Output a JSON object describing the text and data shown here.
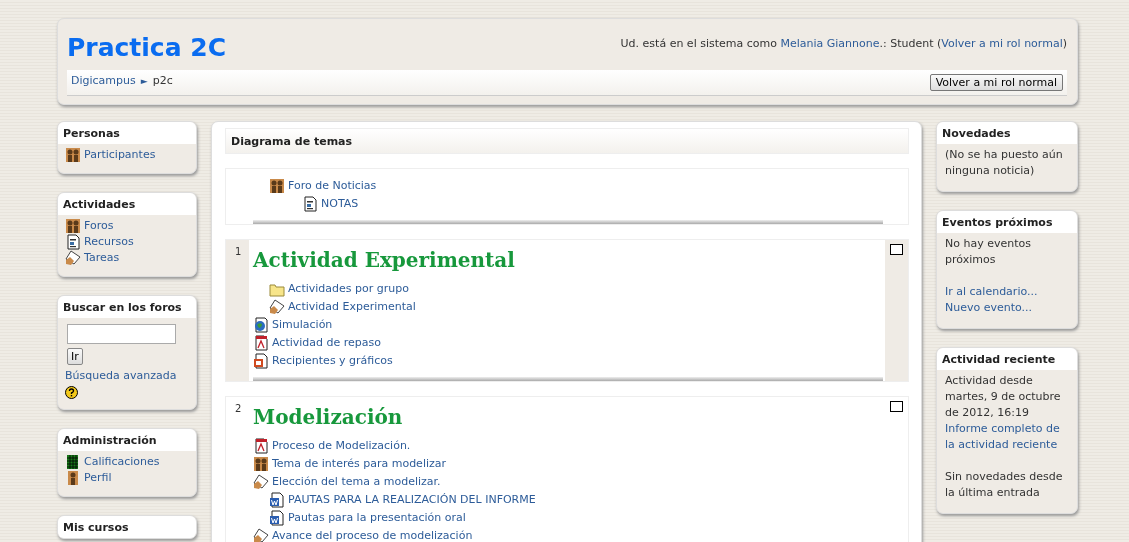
{
  "header": {
    "title": "Practica 2C",
    "login": {
      "prefix": "Ud. está en el sistema como",
      "user": "Melania Giannone",
      "role": ".: Student (",
      "link": "Volver a mi rol normal",
      "suffix": ")"
    },
    "breadcrumb": [
      {
        "label": "Digicampus",
        "link": true
      },
      {
        "label": "p2c",
        "link": false
      }
    ],
    "separator": "►",
    "button": "Volver a mi rol normal"
  },
  "left_blocks": [
    {
      "title": "Personas",
      "kind": "links",
      "items": [
        {
          "kind": "people",
          "label": "Participantes"
        }
      ]
    },
    {
      "title": "Actividades",
      "kind": "links",
      "items": [
        {
          "kind": "forum",
          "label": "Foros"
        },
        {
          "kind": "resource",
          "label": "Recursos"
        },
        {
          "kind": "assignment",
          "label": "Tareas"
        }
      ]
    },
    {
      "title": "Buscar en los foros",
      "kind": "search",
      "button": "Ir",
      "link": "Búsqueda avanzada"
    },
    {
      "title": "Administración",
      "kind": "links",
      "items": [
        {
          "kind": "grades",
          "label": "Calificaciones"
        },
        {
          "kind": "profile",
          "label": "Perfil"
        }
      ]
    },
    {
      "title": "Mis cursos",
      "kind": "links"
    }
  ],
  "main": {
    "title": "Diagrama de temas",
    "sections": [
      {
        "highlighted": false,
        "items": [
          {
            "kind": "forum",
            "label": "Foro de Noticias",
            "children": [
              {
                "kind": "resource",
                "label": "NOTAS"
              }
            ]
          }
        ]
      },
      {
        "number": "1",
        "title": "Actividad Experimental",
        "highlighted": true,
        "items": [
          {
            "children": [
              {
                "kind": "folder",
                "label": "Actividades por grupo"
              },
              {
                "kind": "assignment",
                "label": "Actividad Experimental"
              }
            ]
          },
          {
            "kind": "web",
            "label": "Simulación"
          },
          {
            "kind": "pdf",
            "label": "Actividad de repaso"
          },
          {
            "kind": "slides",
            "label": "Recipientes y gráficos"
          }
        ]
      },
      {
        "number": "2",
        "title": "Modelización",
        "highlighted": false,
        "items": [
          {
            "kind": "pdf",
            "label": "Proceso de Modelización."
          },
          {
            "kind": "forum",
            "label": "Tema de interés para modelizar"
          },
          {
            "kind": "assignment",
            "label": "Elección del tema a modelizar.",
            "children": [
              {
                "kind": "word",
                "label": "PAUTAS PARA LA REALIZACIÓN DEL INFORME"
              },
              {
                "kind": "word",
                "label": "Pautas para la presentación oral"
              }
            ]
          },
          {
            "kind": "assignment",
            "label": "Avance del proceso de modelización"
          }
        ]
      }
    ]
  },
  "right_blocks": [
    {
      "title": "Novedades",
      "paragraphs": [
        [
          {
            "kind": "text",
            "text": "(No se ha puesto aún ninguna noticia)"
          }
        ]
      ]
    },
    {
      "title": "Eventos próximos",
      "paragraphs": [
        [
          {
            "kind": "text",
            "text": "No hay eventos próximos"
          }
        ],
        [
          {
            "kind": "link",
            "text": "Ir al calendario..."
          },
          {
            "kind": "link",
            "text": "Nuevo evento..."
          }
        ]
      ]
    },
    {
      "title": "Actividad reciente",
      "paragraphs": [
        [
          {
            "kind": "text",
            "text": "Actividad desde martes, 9 de octubre de 2012, 16:19"
          },
          {
            "kind": "link",
            "text": "Informe completo de la actividad reciente"
          }
        ],
        [
          {
            "kind": "text",
            "text": "Sin novedades desde la última entrada"
          }
        ]
      ]
    }
  ]
}
